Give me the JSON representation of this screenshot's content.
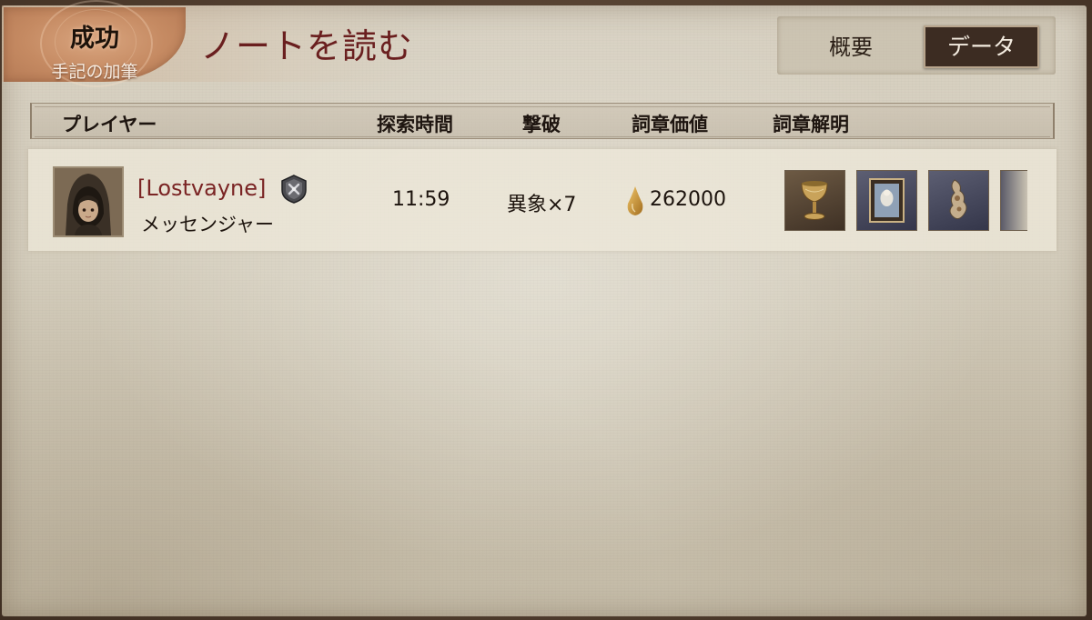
{
  "header": {
    "badge_title": "成功",
    "badge_subtitle": "手記の加筆",
    "page_title": "ノートを読む"
  },
  "tabs": [
    {
      "label": "概要",
      "selected": false
    },
    {
      "label": "データ",
      "selected": true
    }
  ],
  "columns": {
    "player": "プレイヤー",
    "explore_time": "探索時間",
    "defeat": "撃破",
    "emblem_value": "詞章価値",
    "emblem_unlock": "詞章解明"
  },
  "rows": [
    {
      "player_name": "[Lostvayne]",
      "role": "メッセンジャー",
      "explore_time": "11:59",
      "defeat": "異象×7",
      "emblem_value": "262000",
      "icons": [
        "rank-badge-icon",
        "gold-drop-icon"
      ],
      "items": [
        "goblet-icon",
        "framed-painting-icon",
        "ornament-icon",
        "partial-item-icon"
      ]
    }
  ],
  "colors": {
    "title_red": "#6a1f1f",
    "name_red": "#7a2424",
    "tab_selected_bg": "#3c2c22",
    "badge_orange": "#c58a62",
    "paper": "#d3ccbb"
  }
}
